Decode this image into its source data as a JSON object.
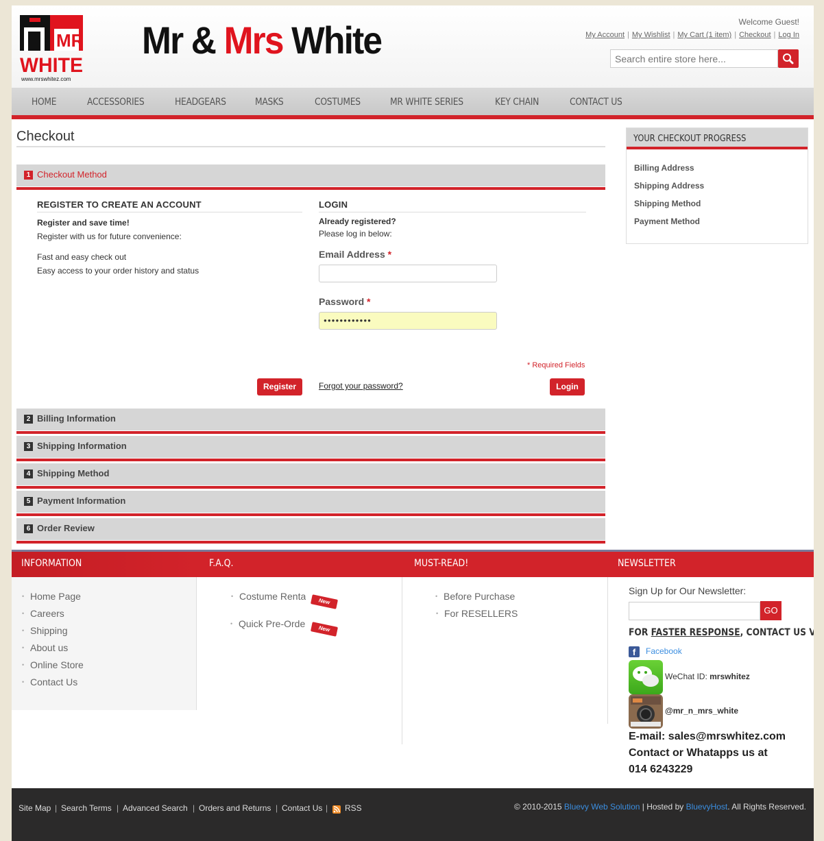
{
  "header": {
    "brand_part1": "Mr & ",
    "brand_part2": "Mrs",
    "brand_part3": " White",
    "logo_letters_top": "MRS",
    "logo_text": "WHITE",
    "logo_url_text": "www.mrswhitez.com",
    "welcome": "Welcome Guest!",
    "links": [
      "My Account",
      "My Wishlist",
      "My Cart (1 item)",
      "Checkout",
      "Log In"
    ],
    "search_placeholder": "Search entire store here..."
  },
  "nav": [
    "HOME",
    "ACCESSORIES",
    "HEADGEARS",
    "MASKS",
    "COSTUMES",
    "MR WHITE SERIES",
    "KEY CHAIN",
    "CONTACT US"
  ],
  "checkout": {
    "title": "Checkout",
    "steps": [
      {
        "num": "1",
        "label": "Checkout Method"
      },
      {
        "num": "2",
        "label": "Billing Information"
      },
      {
        "num": "3",
        "label": "Shipping Information"
      },
      {
        "num": "4",
        "label": "Shipping Method"
      },
      {
        "num": "5",
        "label": "Payment Information"
      },
      {
        "num": "6",
        "label": "Order Review"
      }
    ],
    "register": {
      "heading": "REGISTER TO CREATE AN ACCOUNT",
      "bold_line": "Register and save time!",
      "line1": "Register with us for future convenience:",
      "line2": "Fast and easy check out",
      "line3": "Easy access to your order history and status",
      "button": "Register"
    },
    "login": {
      "heading": "LOGIN",
      "bold_line": "Already registered?",
      "line1": "Please log in below:",
      "email_label": "Email Address",
      "email_value": "",
      "password_label": "Password",
      "password_value": "●●●●●●●●●●●●",
      "required_note": "* Required Fields",
      "forgot": "Forgot your password?",
      "button": "Login"
    }
  },
  "sidebar": {
    "title": "YOUR CHECKOUT PROGRESS",
    "items": [
      "Billing Address",
      "Shipping Address",
      "Shipping Method",
      "Payment Method"
    ]
  },
  "footer": {
    "information": {
      "title": "INFORMATION",
      "links": [
        "Home Page",
        "Careers",
        "Shipping",
        "About us",
        "Online Store",
        "Contact Us"
      ]
    },
    "faq": {
      "title": "F.A.Q.",
      "links": [
        "Costume Rental",
        "Quick Pre-Order"
      ],
      "new_tag": "New"
    },
    "mustread": {
      "title": "MUST-READ!",
      "links": [
        "Before Purchase",
        "For RESELLERS"
      ]
    },
    "newsletter": {
      "title": "NEWSLETTER",
      "signup": "Sign Up for Our Newsletter:",
      "go": "GO",
      "contact_heading_pre": "FOR ",
      "contact_heading_link": "FASTER RESPONSE",
      "contact_heading_post": ", CONTACT US VIA:",
      "facebook": "Facebook",
      "wechat_label": "WeChat ID: ",
      "wechat_id": "mrswhitez",
      "instagram": "@mr_n_mrs_white",
      "email_line": "E-mail: sales@mrswhitez.com",
      "contact_line": "Contact  or Whatapps us at",
      "phone": "014 6243229"
    }
  },
  "bottom": {
    "links": [
      "Site Map",
      "Search Terms",
      "Advanced Search",
      "Orders and Returns",
      "Contact Us",
      "RSS"
    ],
    "copyright_pre": "© 2010-2015 ",
    "copyright_link1": "Bluevy Web Solution",
    "copyright_mid": " | Hosted by ",
    "copyright_link2": "BluevyHost",
    "copyright_post": ". All Rights Reserved."
  },
  "colors": {
    "accent": "#d2232a",
    "nav_bg": "#d0d0d0",
    "page_bg": "#ece6d6",
    "footer_dark": "#2b2a2a",
    "link_blue": "#3b8ee0"
  }
}
